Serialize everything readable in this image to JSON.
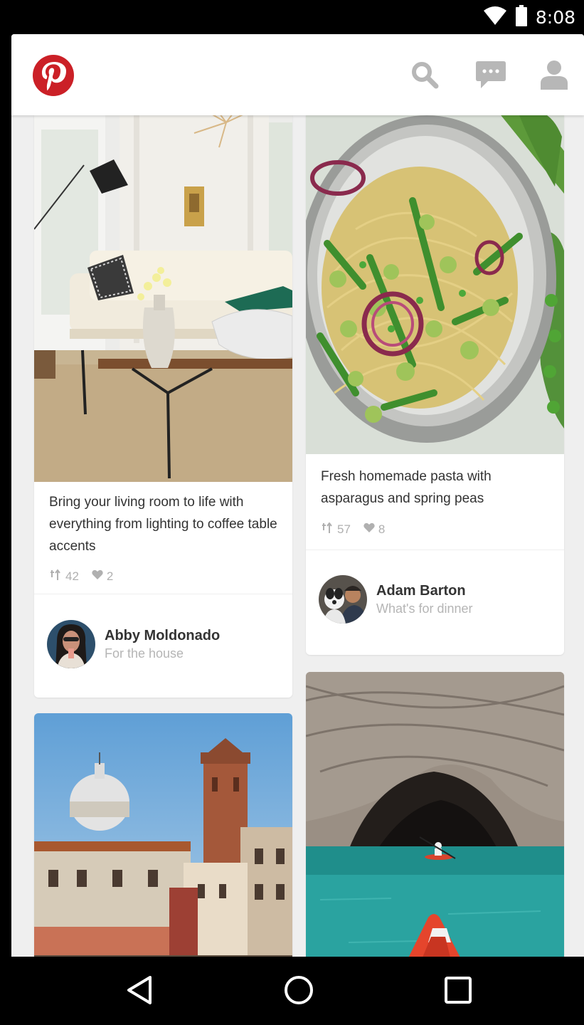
{
  "status_bar": {
    "time": "8:08",
    "icons": [
      "wifi-icon",
      "battery-icon"
    ]
  },
  "app_bar": {
    "logo": "pinterest-logo",
    "actions": [
      "search-icon",
      "messages-icon",
      "profile-icon"
    ],
    "icon_color": "#b7b7b7",
    "brand_color": "#cb2027"
  },
  "feed": {
    "pins": [
      {
        "image": "living-room-photo",
        "description": "Bring your living room to life with everything from lighting to coffee table accents",
        "repins": "42",
        "likes": "2",
        "pinner": {
          "name": "Abby Moldonado",
          "board": "For the house"
        }
      },
      {
        "image": "pasta-photo",
        "description": "Fresh homemade pasta with asparagus and spring peas",
        "repins": "57",
        "likes": "8",
        "pinner": {
          "name": "Adam Barton",
          "board": "What's for dinner"
        }
      },
      {
        "image": "venice-photo"
      },
      {
        "image": "kayak-cave-photo"
      }
    ]
  },
  "nav_bar": {
    "buttons": [
      "back-icon",
      "home-icon",
      "recents-icon"
    ]
  }
}
